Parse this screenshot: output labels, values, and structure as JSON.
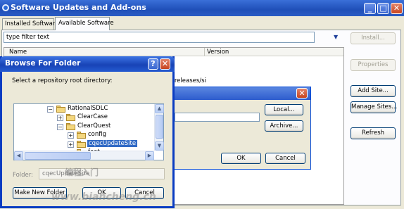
{
  "window": {
    "title": "Software Updates and Add-ons",
    "controls": {
      "minimize": "_",
      "maximize": "□",
      "close": "✕"
    }
  },
  "tabs": [
    {
      "label": "Installed Software",
      "selected": false
    },
    {
      "label": "Available Software",
      "selected": true
    }
  ],
  "filter": {
    "value": "type filter text"
  },
  "table": {
    "columns": [
      "Name",
      "Version"
    ],
    "visible_text": "/releases/si"
  },
  "side_buttons": {
    "install": "Install...",
    "properties": "Properties",
    "add_site": "Add Site...",
    "manage_sites": "Manage Sites...",
    "refresh": "Refresh"
  },
  "add_site_dialog": {
    "local": "Local...",
    "archive": "Archive...",
    "ok": "OK",
    "cancel": "Cancel"
  },
  "browse_dialog": {
    "title": "Browse For Folder",
    "help": "?",
    "prompt": "Select a repository root directory:",
    "tree": [
      {
        "label": "RationalSDLC",
        "expander": "−",
        "selected": false
      },
      {
        "label": "ClearCase",
        "expander": "+",
        "selected": false
      },
      {
        "label": "ClearQuest",
        "expander": "−",
        "selected": false
      },
      {
        "label": "config",
        "expander": "+",
        "selected": false
      },
      {
        "label": "cqecUpdateSite",
        "expander": "+",
        "selected": true
      },
      {
        "label": "feat...",
        "expander": "",
        "selected": false
      }
    ],
    "folder_label": "Folder:",
    "folder_value": "cqecUpdateSite",
    "make_new_folder": "Make New Folder",
    "ok": "OK",
    "cancel": "Cancel"
  },
  "watermark": {
    "line1": "编程入门",
    "line2": "www.biancheng.cn"
  },
  "colors": {
    "titlebar": "#1f4fb8",
    "selection": "#316ac5",
    "dialog_bg": "#ece9d8"
  }
}
